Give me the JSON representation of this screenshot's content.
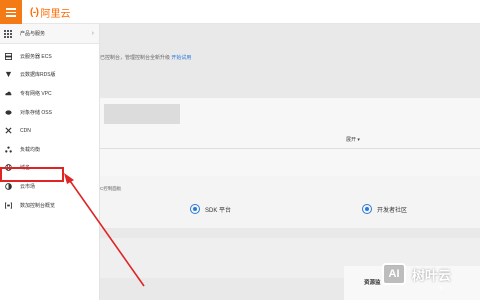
{
  "header": {
    "logo_mark": "(-)",
    "logo_text": "阿里云",
    "brand_color": "#ff6a00"
  },
  "sidebar": {
    "products_label": "产品与服务",
    "items": [
      {
        "label": "云服务器 ECS",
        "icon": "server-icon"
      },
      {
        "label": "云数据库RDS版",
        "icon": "database-icon"
      },
      {
        "label": "专有网络 VPC",
        "icon": "cloud-icon"
      },
      {
        "label": "对象存储 OSS",
        "icon": "storage-icon"
      },
      {
        "label": "CDN",
        "icon": "cdn-icon"
      },
      {
        "label": "负载均衡",
        "icon": "load-balancer-icon"
      },
      {
        "label": "域名",
        "icon": "globe-icon"
      },
      {
        "label": "云市场",
        "icon": "market-icon"
      },
      {
        "label": "数加控制台概览",
        "icon": "console-icon"
      }
    ]
  },
  "main": {
    "intro_text": "已控制台，管理控制台全新升级",
    "intro_link": "开始试用",
    "expand_label": "展开 ▾",
    "panel2_title": "C控制面板",
    "links": [
      {
        "label": "SDK 平台"
      },
      {
        "label": "开发者社区"
      }
    ],
    "resource_label": "资源监"
  },
  "watermark": {
    "box_text": "AI",
    "text": "树叶云",
    "small": "hy"
  }
}
